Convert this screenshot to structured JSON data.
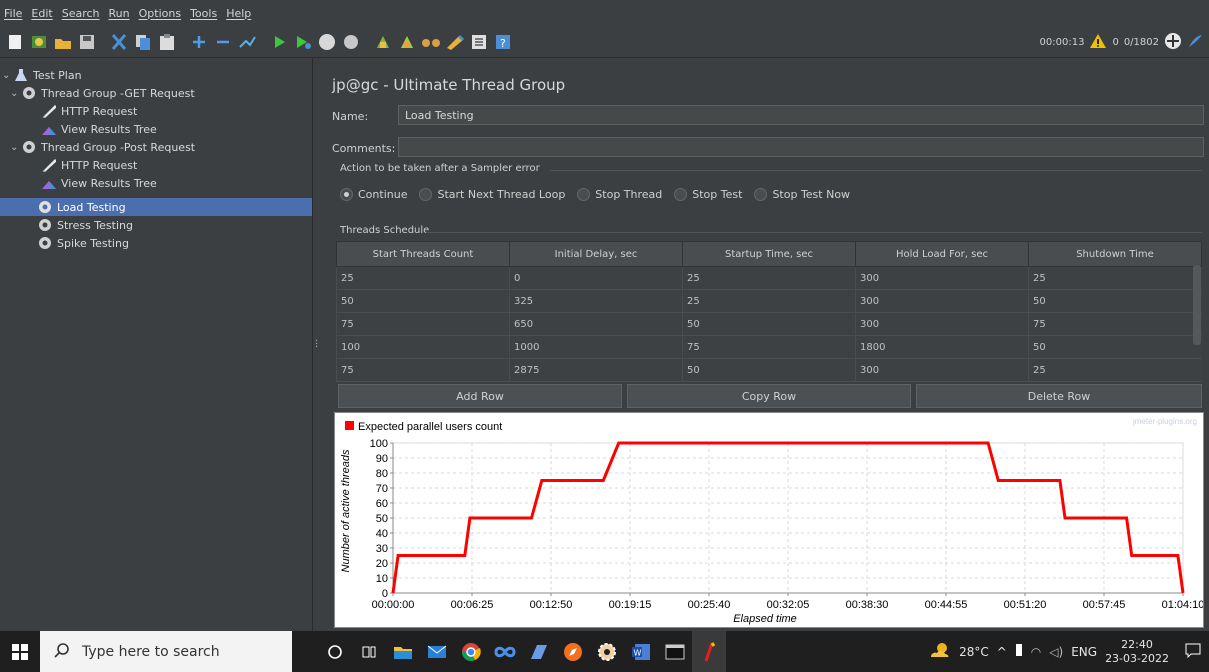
{
  "menu": [
    "File",
    "Edit",
    "Search",
    "Run",
    "Options",
    "Tools",
    "Help"
  ],
  "status": {
    "elapsed": "00:00:13",
    "warnings": "0",
    "threads": "0/1802"
  },
  "tree": {
    "items": [
      {
        "label": "Test Plan"
      },
      {
        "label": "Thread Group -GET Request"
      },
      {
        "label": "HTTP Request"
      },
      {
        "label": "View Results Tree"
      },
      {
        "label": "Thread Group -Post Request"
      },
      {
        "label": "HTTP Request"
      },
      {
        "label": "View Results Tree"
      },
      {
        "label": "Load Testing"
      },
      {
        "label": "Stress Testing"
      },
      {
        "label": "Spike Testing"
      }
    ]
  },
  "panel": {
    "title": "jp@gc - Ultimate Thread Group",
    "name_label": "Name:",
    "name_value": "Load Testing",
    "comments_label": "Comments:",
    "comments_value": "",
    "sampler_error_title": "Action to be taken after a Sampler error",
    "radios": [
      "Continue",
      "Start Next Thread Loop",
      "Stop Thread",
      "Stop Test",
      "Stop Test Now"
    ],
    "radio_selected": "Continue",
    "schedule_title": "Threads Schedule",
    "columns": [
      "Start Threads Count",
      "Initial Delay, sec",
      "Startup Time, sec",
      "Hold Load For, sec",
      "Shutdown Time"
    ],
    "rows": [
      [
        "25",
        "0",
        "25",
        "300",
        "25"
      ],
      [
        "50",
        "325",
        "25",
        "300",
        "50"
      ],
      [
        "75",
        "650",
        "50",
        "300",
        "75"
      ],
      [
        "100",
        "1000",
        "75",
        "1800",
        "50"
      ],
      [
        "75",
        "2875",
        "50",
        "300",
        "25"
      ]
    ],
    "buttons": {
      "add": "Add Row",
      "copy": "Copy Row",
      "delete": "Delete Row"
    }
  },
  "chart_data": {
    "type": "line",
    "legend": "Expected parallel users count",
    "watermark": "jmeter-plugins.org",
    "xlabel": "Elapsed time",
    "ylabel": "Number of active threads",
    "yticks": [
      "0",
      "10",
      "20",
      "30",
      "40",
      "50",
      "60",
      "70",
      "80",
      "90",
      "100"
    ],
    "xticks": [
      "00:00:00",
      "00:06:25",
      "00:12:50",
      "00:19:15",
      "00:25:40",
      "00:32:05",
      "00:38:30",
      "00:44:55",
      "00:51:20",
      "00:57:45",
      "01:04:10"
    ],
    "ylim": [
      0,
      100
    ],
    "xlim": [
      0,
      3850
    ],
    "series": [
      {
        "color": "#ff0000",
        "points": [
          [
            0,
            0
          ],
          [
            25,
            25
          ],
          [
            350,
            25
          ],
          [
            375,
            50
          ],
          [
            675,
            50
          ],
          [
            725,
            75
          ],
          [
            1025,
            75
          ],
          [
            1100,
            100
          ],
          [
            2900,
            100
          ],
          [
            2950,
            75
          ],
          [
            3250,
            75
          ],
          [
            3275,
            50
          ],
          [
            3575,
            50
          ],
          [
            3600,
            25
          ],
          [
            3825,
            25
          ],
          [
            3850,
            0
          ]
        ]
      }
    ]
  },
  "taskbar": {
    "search_placeholder": "Type here to search",
    "weather": "28°C",
    "lang": "ENG",
    "time": "22:40",
    "date": "23-03-2022"
  }
}
